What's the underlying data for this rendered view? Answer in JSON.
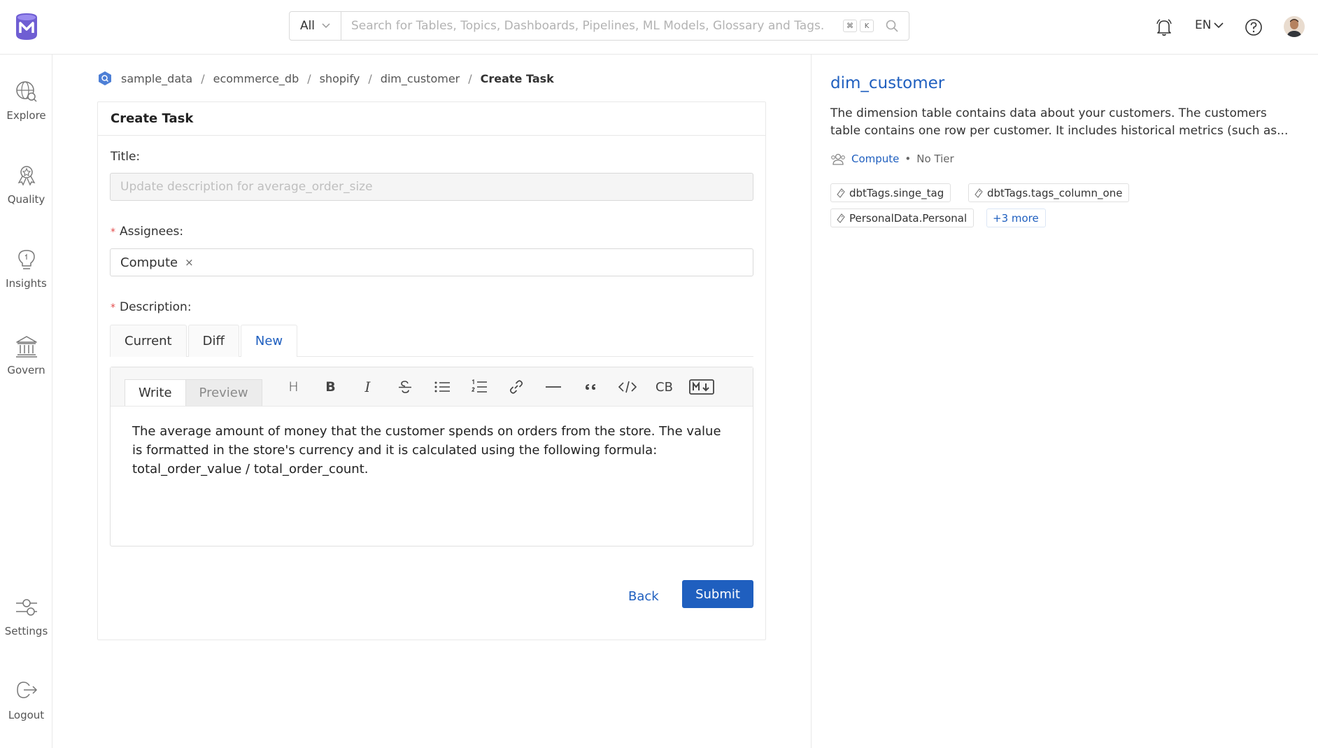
{
  "header": {
    "search_scope": "All",
    "search_placeholder": "Search for Tables, Topics, Dashboards, Pipelines, ML Models, Glossary and Tags.",
    "shortcut_keys": [
      "⌘",
      "K"
    ],
    "language": "EN"
  },
  "nav": {
    "items": [
      {
        "label": "Explore",
        "icon": "explore-icon"
      },
      {
        "label": "Quality",
        "icon": "quality-icon"
      },
      {
        "label": "Insights",
        "icon": "insights-icon"
      },
      {
        "label": "Govern",
        "icon": "govern-icon"
      },
      {
        "label": "Settings",
        "icon": "settings-icon"
      },
      {
        "label": "Logout",
        "icon": "logout-icon"
      }
    ]
  },
  "breadcrumb": {
    "items": [
      "sample_data",
      "ecommerce_db",
      "shopify",
      "dim_customer"
    ],
    "current": "Create Task"
  },
  "form": {
    "heading": "Create Task",
    "title_label": "Title:",
    "title_placeholder": "Update description for average_order_size",
    "assignees_label": "Assignees:",
    "assignee_chip": "Compute",
    "chip_remove": "×",
    "description_label": "Description:",
    "tabs": [
      "Current",
      "Diff",
      "New"
    ],
    "editor_tabs": {
      "write": "Write",
      "preview": "Preview"
    },
    "toolbar": {
      "heading": "H",
      "bold": "B",
      "italic": "I",
      "codeblock": "CB"
    },
    "description_text": "The average amount of money that the customer spends on orders from the store. The value is formatted in the store's currency and it is calculated using the following formula: total_order_value / total_order_count.",
    "back_label": "Back",
    "submit_label": "Submit"
  },
  "entity": {
    "name": "dim_customer",
    "description": "The dimension table contains data about your customers. The customers table contains one row per customer. It includes historical metrics (such as...",
    "owner": "Compute",
    "separator": "•",
    "tier": "No Tier",
    "tags": [
      "dbtTags.singe_tag",
      "dbtTags.tags_column_one",
      "PersonalData.Personal"
    ],
    "more_tags": "+3 more"
  },
  "colors": {
    "accent": "#1f5fbf",
    "required": "#e34d4d"
  }
}
